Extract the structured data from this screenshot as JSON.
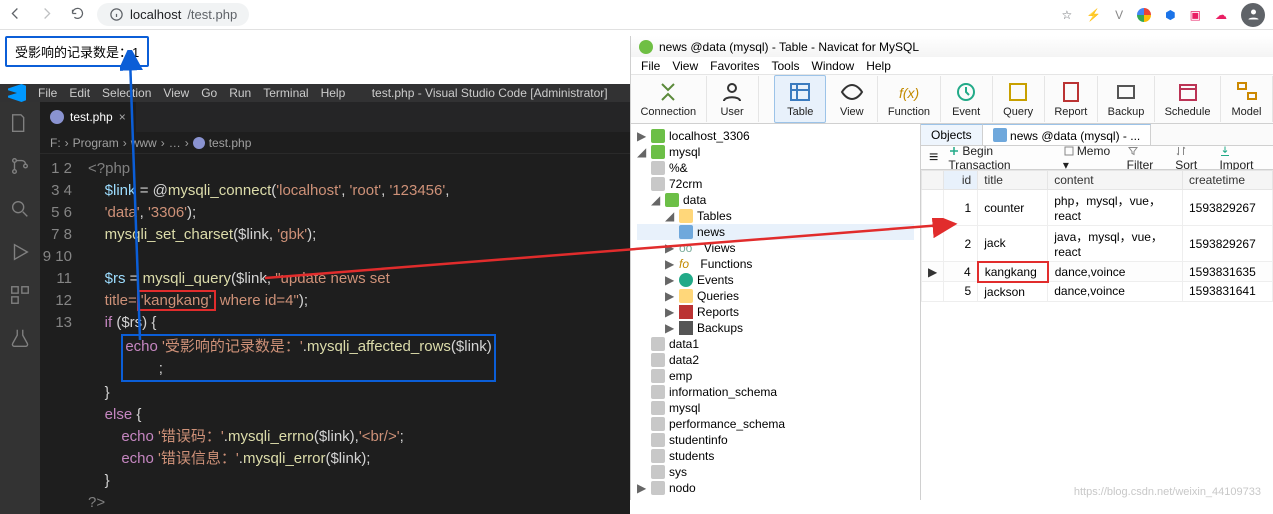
{
  "browser": {
    "url_host": "localhost",
    "url_path": "/test.php"
  },
  "result_text": "受影响的记录数是：1",
  "vscode": {
    "menu": [
      "File",
      "Edit",
      "Selection",
      "View",
      "Go",
      "Run",
      "Terminal",
      "Help"
    ],
    "title": "test.php - Visual Studio Code [Administrator]",
    "tab": "test.php",
    "breadcrumb": [
      "F:",
      "Program",
      "www",
      "…",
      "test.php"
    ],
    "code": {
      "l1_open": "<?php",
      "l2_a": "$link",
      "l2_b": " = @",
      "l2_c": "mysqli_connect",
      "l2_d": "(",
      "l2_s1": "'localhost'",
      "l2_s2": "'root'",
      "l2_s3": "'123456'",
      "l2_e": ",",
      "l3_s1": "'data'",
      "l3_s2": "'3306'",
      "l3_end": ");",
      "l4_a": "mysqli_set_charset",
      "l4_b": "($link, ",
      "l4_s": "'gbk'",
      "l4_e": ");",
      "l6_a": "$rs",
      "l6_b": " = ",
      "l6_c": "mysqli_query",
      "l6_d": "($link, ",
      "l6_s1": "\"update news set",
      "l6_s2": "title=",
      "l6_hl": "'kangkang'",
      "l6_s3": " where id=4\"",
      "l6_e": ");",
      "l7_a": "if",
      "l7_b": " ($rs) {",
      "l8_a": "echo ",
      "l8_s": "'受影响的记录数是：'",
      "l8_b": ".",
      "l8_c": "mysqli_affected_rows",
      "l8_d": "($link)",
      "l8_e": ";",
      "l9": "}",
      "l10_a": "else",
      "l10_b": " {",
      "l11_a": "echo ",
      "l11_s": "'错误码：'",
      "l11_b": ".",
      "l11_c": "mysqli_errno",
      "l11_d": "($link),",
      "l11_s2": "'<br/>'",
      "l11_e": ";",
      "l12_a": "echo ",
      "l12_s": "'错误信息：'",
      "l12_b": ".",
      "l12_c": "mysqli_error",
      "l12_d": "($link);",
      "l13": "}",
      "l14": "?>"
    }
  },
  "navicat": {
    "title": "news @data (mysql) - Table - Navicat for MySQL",
    "menu": [
      "File",
      "View",
      "Favorites",
      "Tools",
      "Window",
      "Help"
    ],
    "tools": [
      "Connection",
      "User",
      "Table",
      "View",
      "Function",
      "Event",
      "Query",
      "Report",
      "Backup",
      "Schedule",
      "Model"
    ],
    "tree": {
      "conn": "localhost_3306",
      "srv": "mysql",
      "dbs_special": [
        "%&",
        "72crm"
      ],
      "db_open": "data",
      "tables_node": "Tables",
      "table": "news",
      "other_nodes": [
        "Views",
        "Functions",
        "Events",
        "Queries",
        "Reports",
        "Backups"
      ],
      "off_dbs": [
        "data1",
        "data2",
        "emp",
        "information_schema",
        "mysql",
        "performance_schema",
        "studentinfo",
        "students",
        "sys"
      ],
      "off_conn": "nodo"
    },
    "tabs": [
      "Objects",
      "news @data (mysql) - ..."
    ],
    "obj_toolbar": {
      "menu_icon": "≡",
      "begin": "Begin Transaction",
      "memo": "Memo",
      "filter": "Filter",
      "sort": "Sort",
      "import": "Import"
    },
    "cols": [
      "id",
      "title",
      "content",
      "createtime"
    ],
    "rows": [
      {
        "id": "1",
        "title": "counter",
        "content": "php，mysql，vue，react",
        "createtime": "1593829267",
        "ptr": ""
      },
      {
        "id": "2",
        "title": "jack",
        "content": "java，mysql，vue，react",
        "createtime": "1593829267",
        "ptr": ""
      },
      {
        "id": "4",
        "title": "kangkang",
        "content": "dance,voince",
        "createtime": "1593831635",
        "ptr": "▶"
      },
      {
        "id": "5",
        "title": "jackson",
        "content": "dance,voince",
        "createtime": "1593831641",
        "ptr": ""
      }
    ]
  },
  "watermark": "https://blog.csdn.net/weixin_44109733",
  "chart_data": {
    "type": "table",
    "title": "news @data (mysql)",
    "columns": [
      "id",
      "title",
      "content",
      "createtime"
    ],
    "rows": [
      [
        1,
        "counter",
        "php，mysql，vue，react",
        1593829267
      ],
      [
        2,
        "jack",
        "java，mysql，vue，react",
        1593829267
      ],
      [
        4,
        "kangkang",
        "dance,voince",
        1593831635
      ],
      [
        5,
        "jackson",
        "dance,voince",
        1593831641
      ]
    ]
  }
}
